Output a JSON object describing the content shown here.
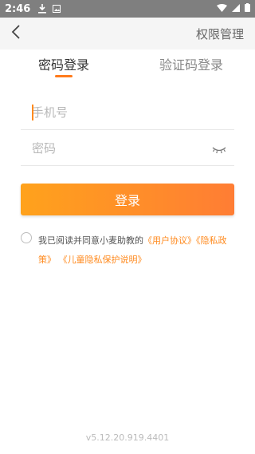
{
  "status_bar": {
    "time": "2:46",
    "icons": [
      "download-icon",
      "image-notification-icon",
      "wifi-icon",
      "signal-icon",
      "battery-icon"
    ]
  },
  "nav": {
    "back_icon": "chevron-left-icon",
    "action_label": "权限管理"
  },
  "tabs": {
    "password_login": "密码登录",
    "code_login": "验证码登录",
    "active": "password_login"
  },
  "form": {
    "phone_placeholder": "手机号",
    "phone_value": "",
    "password_placeholder": "密码",
    "password_value": "",
    "eye_icon": "eye-closed-icon"
  },
  "login_button_label": "登录",
  "agreement": {
    "checked": false,
    "prefix": "我已阅读并同意小麦助教的",
    "user_agreement": "《用户协议》",
    "privacy_policy": "《隐私政策》",
    "child_privacy": "《儿童隐私保护说明》"
  },
  "version": "v5.12.20.919.4401",
  "colors": {
    "accent": "#ff8a1e",
    "button_start": "#ffa21c",
    "button_end": "#ff7d34",
    "status_bar": "#7f7f7f"
  }
}
